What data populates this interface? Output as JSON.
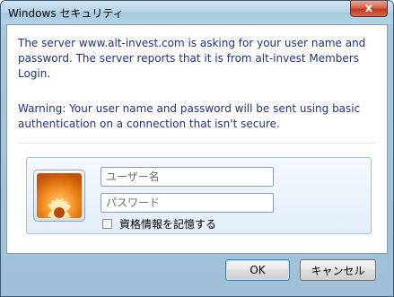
{
  "window": {
    "title": "Windows セキュリティ",
    "close_glyph": "x"
  },
  "content": {
    "message1": "The server www.alt-invest.com is asking for your user name and password. The server reports that it is from alt-invest Members Login.",
    "message2": "Warning: Your user name and password will be sent using basic authentication on a connection that isn't secure."
  },
  "credentials": {
    "avatar_icon": "user-picture-icon",
    "username_placeholder": "ユーザー名",
    "username_value": "",
    "password_placeholder": "パスワード",
    "password_value": "",
    "remember_label": "資格情報を記憶する",
    "remember_checked": false
  },
  "buttons": {
    "ok_label": "OK",
    "cancel_label": "キャンセル"
  },
  "colors": {
    "message_text": "#1e3287",
    "frame": "#a7c7dd",
    "close_button": "#c2391f"
  }
}
